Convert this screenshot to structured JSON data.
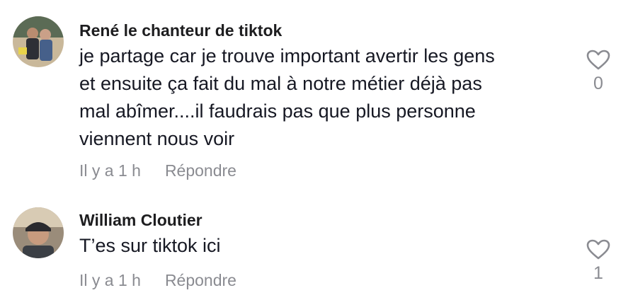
{
  "comments": [
    {
      "author": "René le chanteur de tiktok",
      "lines": [
        "je partage car je trouve important avertir les gens",
        "et ensuite ça fait du mal à notre métier déjà pas",
        "mal abîmer....il faudrais pas que plus personne",
        "viennent nous voir"
      ],
      "time": "Il y a 1 h",
      "reply_label": "Répondre",
      "likes": "0"
    },
    {
      "author": "William Cloutier",
      "lines": [
        "T’es sur tiktok ici"
      ],
      "time": "Il y a 1 h",
      "reply_label": "Répondre",
      "likes": "1"
    }
  ],
  "colors": {
    "muted": "#8a8b91",
    "text": "#161823"
  },
  "icons": {
    "like": "heart-outline-icon"
  }
}
